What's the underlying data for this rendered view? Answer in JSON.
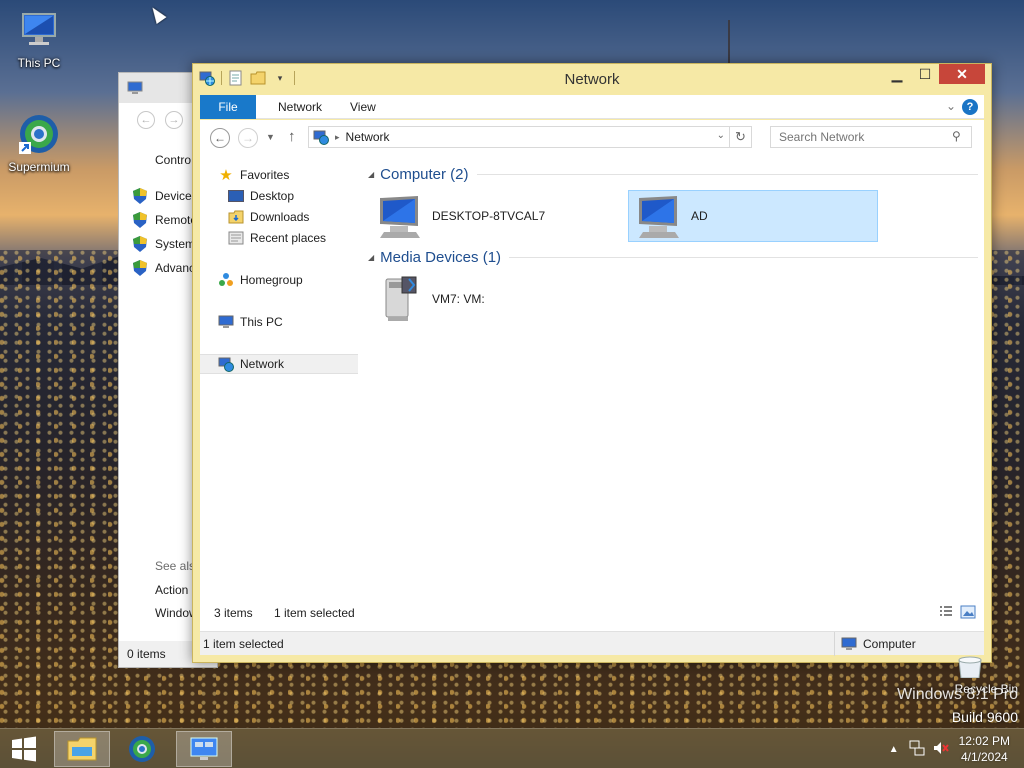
{
  "desktop": {
    "icons": [
      {
        "label": "This PC",
        "icon": "monitor-icon"
      },
      {
        "label": "Supermium",
        "icon": "browser-icon"
      },
      {
        "label": "Recycle Bin",
        "icon": "recycle-bin-icon"
      }
    ],
    "watermark": {
      "line1": "Windows 8.1 Pro",
      "line2": "Build 9600"
    }
  },
  "bg_window": {
    "links": [
      "Contro",
      "Device",
      "Remote",
      "System",
      "Advanc"
    ],
    "see_also": "See also",
    "bottom_links": [
      "Action",
      "Window"
    ],
    "status": "0 items"
  },
  "explorer": {
    "title": "Network",
    "ribbon_tabs": {
      "file": "File",
      "network": "Network",
      "view": "View"
    },
    "help": "?",
    "address": {
      "crumb": "Network",
      "search_placeholder": "Search Network"
    },
    "nav": {
      "favorites": "Favorites",
      "desktop": "Desktop",
      "downloads": "Downloads",
      "recent": "Recent places",
      "homegroup": "Homegroup",
      "this_pc": "This PC",
      "network": "Network"
    },
    "groups": [
      {
        "title": "Computer (2)",
        "items": [
          "DESKTOP-8TVCAL7",
          "AD"
        ]
      },
      {
        "title": "Media Devices (1)",
        "items": [
          "VM7: VM:"
        ]
      }
    ],
    "status": {
      "count": "3 items",
      "selected": "1 item selected"
    },
    "details_bar": {
      "left": "1 item selected",
      "zone": "Computer"
    }
  },
  "taskbar": {
    "time": "12:02 PM",
    "date": "4/1/2024"
  },
  "colors": {
    "accent": "#1979ca",
    "title_bar": "#f6e9a6",
    "selection": "#cce8ff",
    "close": "#c7463a"
  }
}
